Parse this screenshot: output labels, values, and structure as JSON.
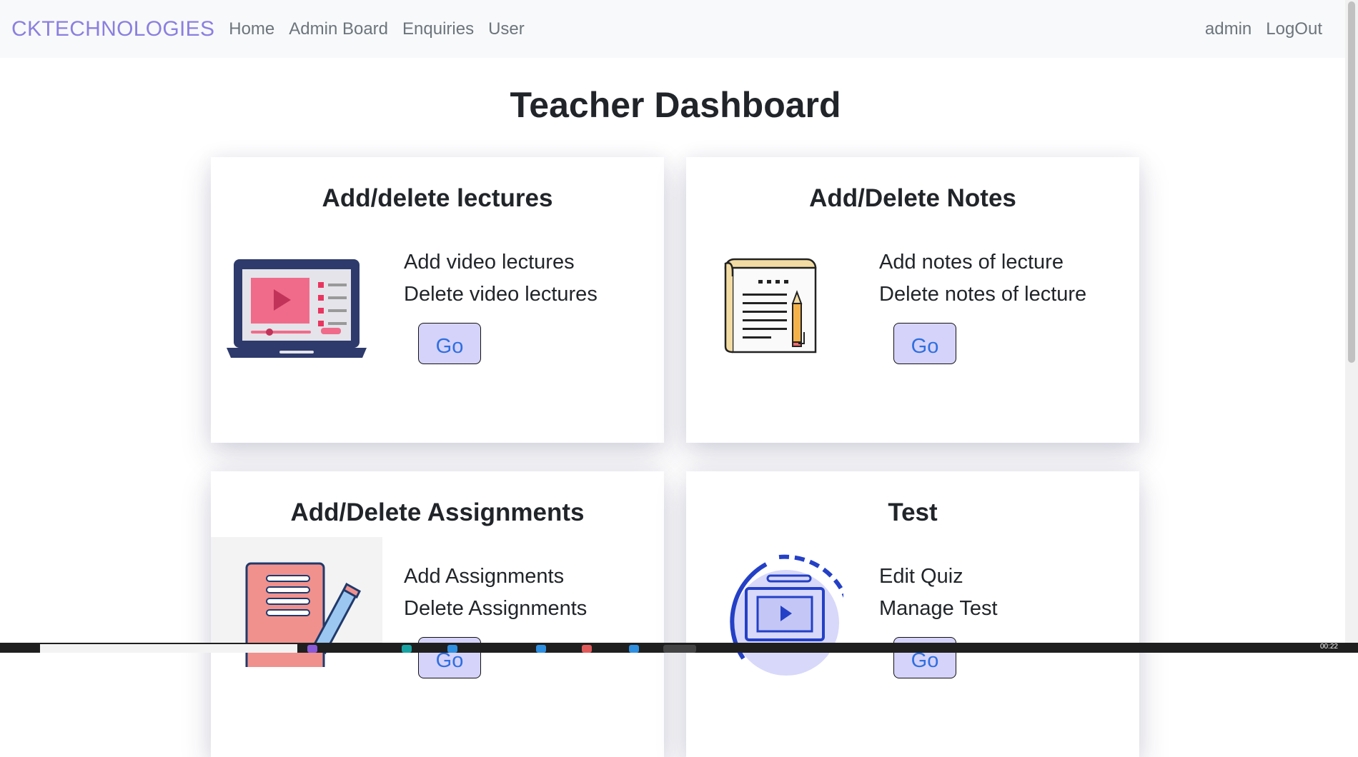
{
  "navbar": {
    "brand": "CKTECHNOLOGIES",
    "links": [
      "Home",
      "Admin Board",
      "Enquiries",
      "User"
    ],
    "user": "admin",
    "logout": "LogOut"
  },
  "page": {
    "title": "Teacher Dashboard"
  },
  "cards": [
    {
      "title": "Add/delete lectures",
      "lines": [
        "Add video lectures",
        "Delete video lectures"
      ],
      "button": "Go",
      "icon": "laptop-video-icon"
    },
    {
      "title": "Add/Delete Notes",
      "lines": [
        "Add notes of lecture",
        "Delete notes of lecture"
      ],
      "button": "Go",
      "icon": "notepad-pencil-icon"
    },
    {
      "title": "Add/Delete Assignments",
      "lines": [
        "Add Assignments",
        "Delete Assignments"
      ],
      "button": "Go",
      "icon": "assignment-pencil-icon"
    },
    {
      "title": "Test",
      "lines": [
        "Edit Quiz",
        "Manage Test"
      ],
      "button": "Go",
      "icon": "online-test-icon"
    }
  ],
  "taskbar": {
    "clock": "00:22"
  },
  "colors": {
    "brand": "#8b7fe0",
    "button_bg": "#d5d3fa",
    "button_text": "#2f6fe0",
    "navbar_bg": "#f8f9fa"
  }
}
